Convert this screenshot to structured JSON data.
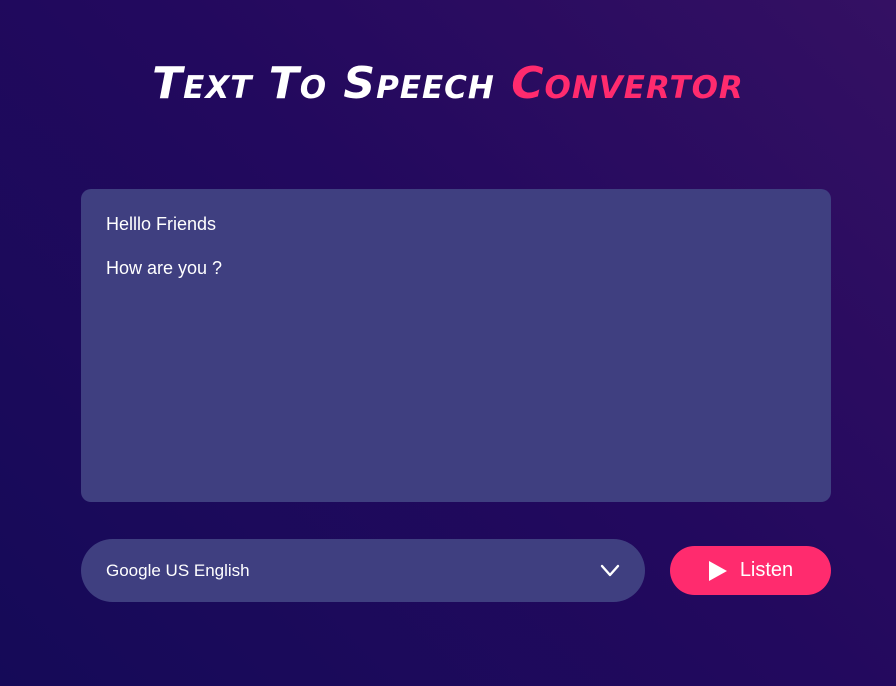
{
  "header": {
    "title_part1": "Text To Speech",
    "title_part2": "Convertor"
  },
  "textarea": {
    "lines": [
      "Helllo Friends",
      "How are you ?"
    ]
  },
  "voice_select": {
    "selected": "Google US English",
    "icon": "chevron-down-icon"
  },
  "listen_button": {
    "label": "Listen",
    "icon": "play-icon"
  },
  "colors": {
    "accent": "#ff2b6e",
    "panel": "#3f3f80",
    "text": "#ffffff"
  }
}
